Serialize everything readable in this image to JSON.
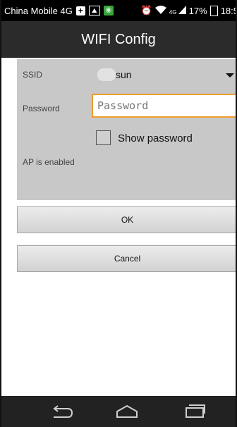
{
  "status_bar": {
    "carrier": "China Mobile 4G",
    "network_label": "4G",
    "battery": "17%",
    "time": "18:5"
  },
  "title": "WIFI Config",
  "form": {
    "ssid_label": "SSID",
    "ssid_value": "sun",
    "password_label": "Password",
    "password_placeholder": "Password",
    "show_password_label": "Show password",
    "ap_status": "AP is enabled"
  },
  "buttons": {
    "ok": "OK",
    "cancel": "Cancel"
  },
  "colors": {
    "status_bar": "#000000",
    "title_bar": "#2b2b2b",
    "panel": "#c8c8c8",
    "focus_accent": "#f09c2c",
    "nav_bar": "#222222"
  }
}
